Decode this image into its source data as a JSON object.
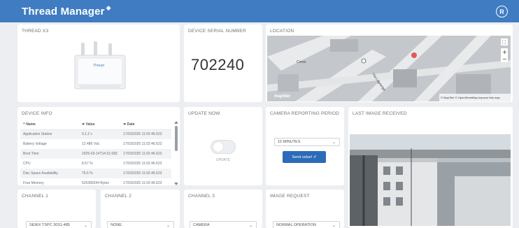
{
  "header": {
    "title": "Thread Manager",
    "avatar_initial": "R"
  },
  "device_card": {
    "title": "THREAD X3",
    "device_brand": "Thread"
  },
  "serial_card": {
    "title": "DEVICE SERIAL NUMBER",
    "value": "702240"
  },
  "location_card": {
    "title": "LOCATION",
    "street_labels": [
      "Corso",
      "Via Lagrange"
    ],
    "attribution": "© MapTiler © OpenStreetMap Improve this map",
    "logo_text": "maptiler"
  },
  "device_info": {
    "title": "DEVICE INFO",
    "columns": [
      "^ Name",
      "≑ Value",
      "≑ Date"
    ],
    "rows": [
      [
        "Application Station",
        "0.1.2 v",
        "17/03/2025 11:02:46.623"
      ],
      [
        "Battery Voltage",
        "12.486 Vdc",
        "17/03/2025 11:02:46.623"
      ],
      [
        "Boot Time",
        "2025-03-14T14:31:08Z",
        "17/03/2025 11:02:46.623"
      ],
      [
        "CPU",
        "8.57 %",
        "17/03/2025 11:02:46.623"
      ],
      [
        "Disc Space Availability",
        "75.6 %",
        "17/03/2025 11:02:46.623"
      ],
      [
        "Free Memory",
        "625289344 Bytes",
        "17/03/2025 11:02:46.623"
      ]
    ]
  },
  "update_now": {
    "title": "UPDATE NOW",
    "toggle_label": "UPDATE"
  },
  "camera_period": {
    "title": "CAMERA REPORTING PERIOD",
    "selected": "15 MINUTES",
    "send_label": "Send value! ✐"
  },
  "last_image": {
    "title": "LAST IMAGE RECEIVED"
  },
  "channel1": {
    "title": "CHANNEL 1",
    "selected": "SENIX TSPC 30S1-485"
  },
  "channel2": {
    "title": "CHANNEL 2",
    "selected": "NONE"
  },
  "channel3": {
    "title": "CHANNEL 3",
    "selected": "CAMERA"
  },
  "image_request": {
    "title": "IMAGE REQUEST",
    "selected": "NORMAL OPERATION"
  },
  "icons": {
    "brand": "wifi-badge-icon",
    "zoom_in": "plus-icon",
    "zoom_out": "minus-icon",
    "fullscreen": "expand-icon",
    "chevron": "chevron-down-icon"
  },
  "colors": {
    "header": "#3f7cc2",
    "button": "#2c6bb8",
    "background": "#eceef1"
  }
}
